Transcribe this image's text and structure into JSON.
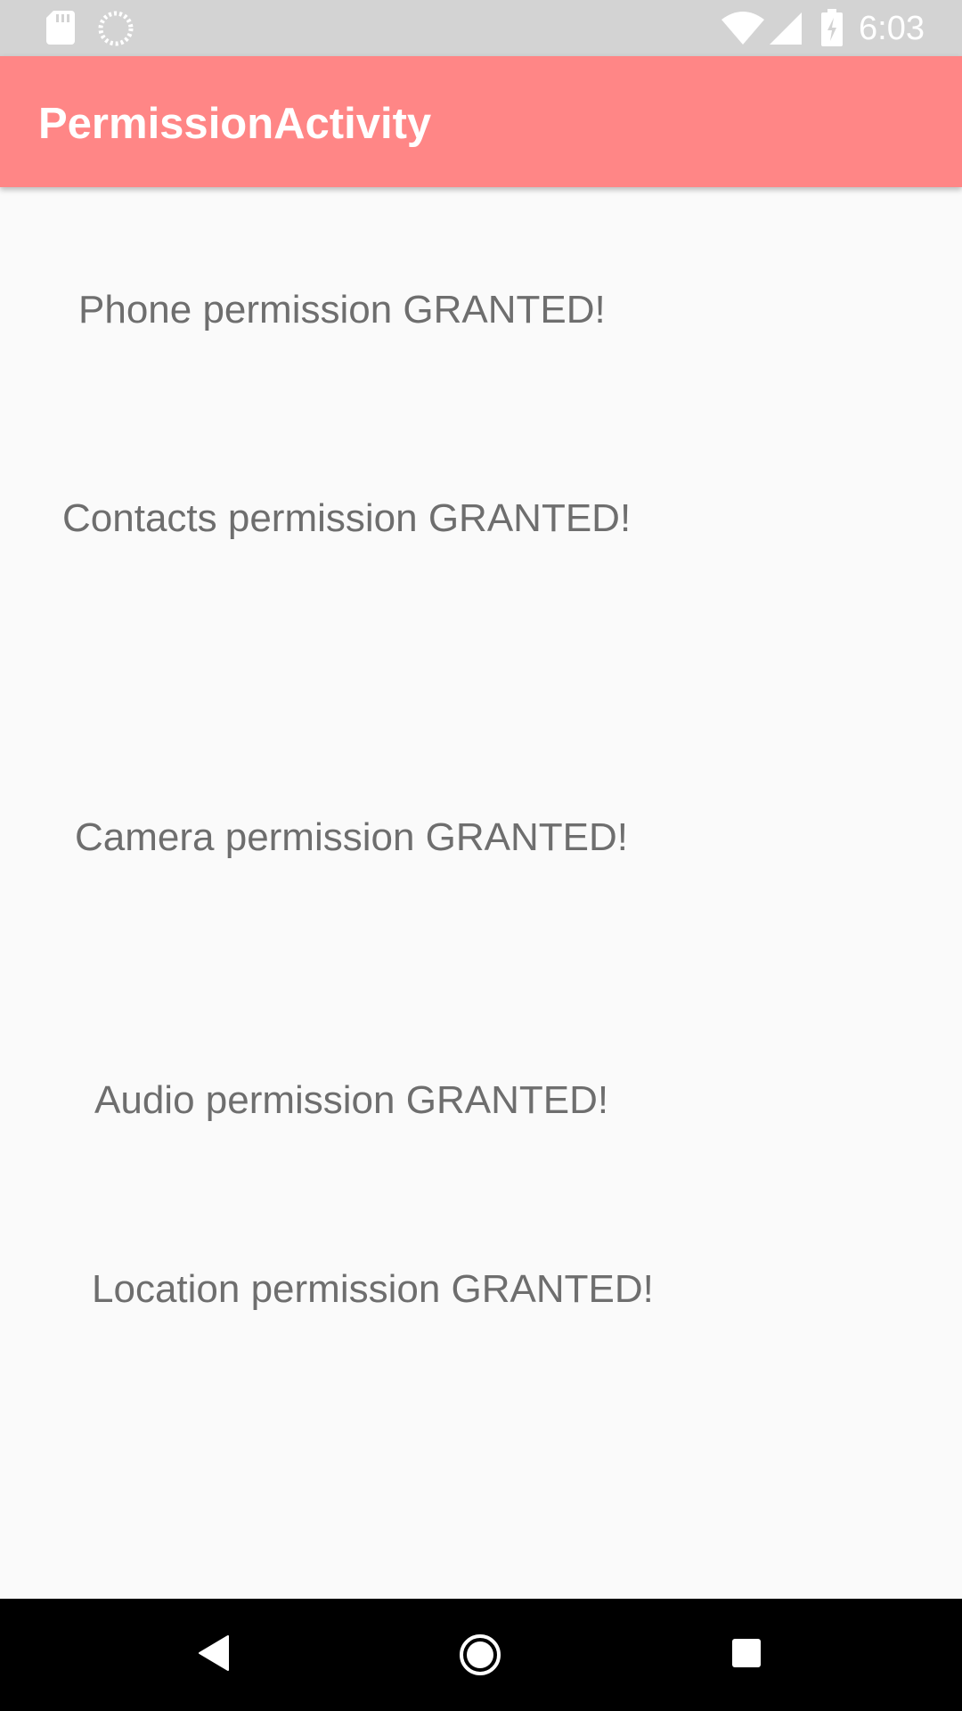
{
  "status_bar": {
    "time": "6:03",
    "icons": [
      "sd-card-icon",
      "sync-icon",
      "wifi-icon",
      "signal-icon",
      "battery-charging-icon"
    ]
  },
  "app_bar": {
    "title": "PermissionActivity",
    "color": "#ff8686"
  },
  "permissions": [
    "Phone permission GRANTED!",
    "Contacts permission GRANTED!",
    "Camera permission GRANTED!",
    "Audio permission GRANTED!",
    "Location permission GRANTED!"
  ],
  "nav_bar": {
    "buttons": [
      "back-icon",
      "home-icon",
      "recents-icon"
    ]
  }
}
